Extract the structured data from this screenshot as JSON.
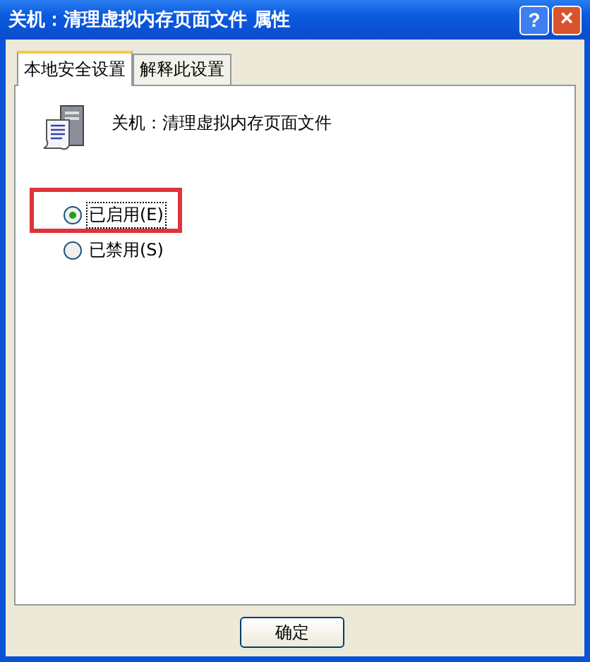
{
  "window": {
    "title": "关机：清理虚拟内存页面文件 属性",
    "help": "?",
    "close": "×"
  },
  "tabs": [
    {
      "label": "本地安全设置",
      "selected": true
    },
    {
      "label": "解释此设置",
      "selected": false
    }
  ],
  "policy": {
    "name": "关机：清理虚拟内存页面文件"
  },
  "options": [
    {
      "label": "已启用(E)",
      "selected": true,
      "focused": true
    },
    {
      "label": "已禁用(S)",
      "selected": false,
      "focused": false
    }
  ],
  "buttons": [
    "确定"
  ]
}
